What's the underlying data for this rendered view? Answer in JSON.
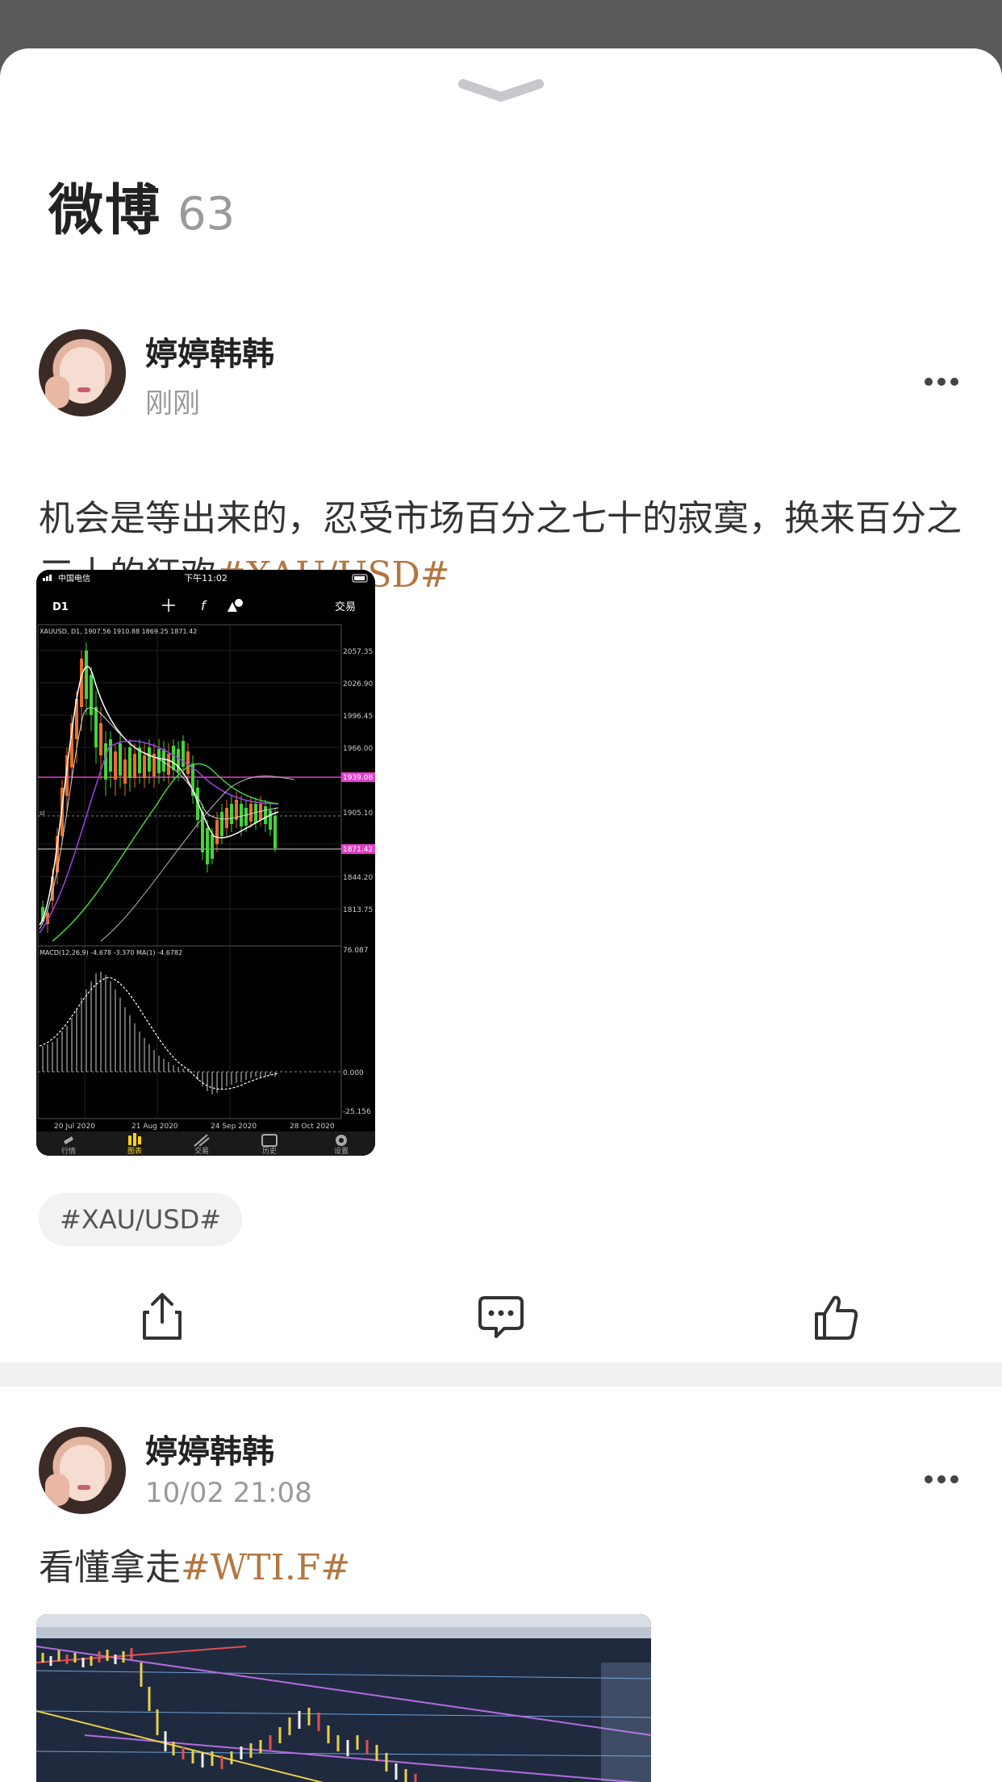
{
  "header": {
    "title": "微博",
    "count": "63"
  },
  "posts": [
    {
      "user": "婷婷韩韩",
      "time": "刚刚",
      "text": "机会是等出来的，忍受市场百分之七十的寂寞，换来百分之三十的狂欢",
      "hashtag": "#XAU/USD#",
      "tag_chip": "#XAU/USD#"
    },
    {
      "user": "婷婷韩韩",
      "time": "10/02 21:08",
      "text": "看懂拿走",
      "hashtag": "#WTI.F#"
    }
  ],
  "screenshot1": {
    "status": {
      "carrier": "中国电信",
      "time": "下午11:02"
    },
    "toolbar": {
      "timeframe": "D1",
      "trade": "交易"
    },
    "symbol_info": "XAUUSD, D1, 1907.56 1910.88 1869.25 1871.42",
    "price_labels": [
      "2057.35",
      "2026.90",
      "1996.45",
      "1966.00",
      "1939.08",
      "1905.10",
      "1871.42",
      "1844.20",
      "1813.75"
    ],
    "macd_info": "MACD(12,26,9) -4.678 -3.370 MA(1) -4.6782",
    "macd_labels": [
      "76.087",
      "0.000",
      "-25.156"
    ],
    "dates": [
      "20 Jul 2020",
      "21 Aug 2020",
      "24 Sep 2020",
      "28 Oct 2020"
    ],
    "tabs": [
      "行情",
      "图表",
      "交易",
      "历史",
      "设置"
    ],
    "colors": {
      "bull": "#43d33a",
      "bear": "#e8702a",
      "accent": "#ffd21a",
      "marker": "#e040c8"
    }
  },
  "colors": {
    "hashtag": "#b37640",
    "overlay": "#5a595b"
  }
}
